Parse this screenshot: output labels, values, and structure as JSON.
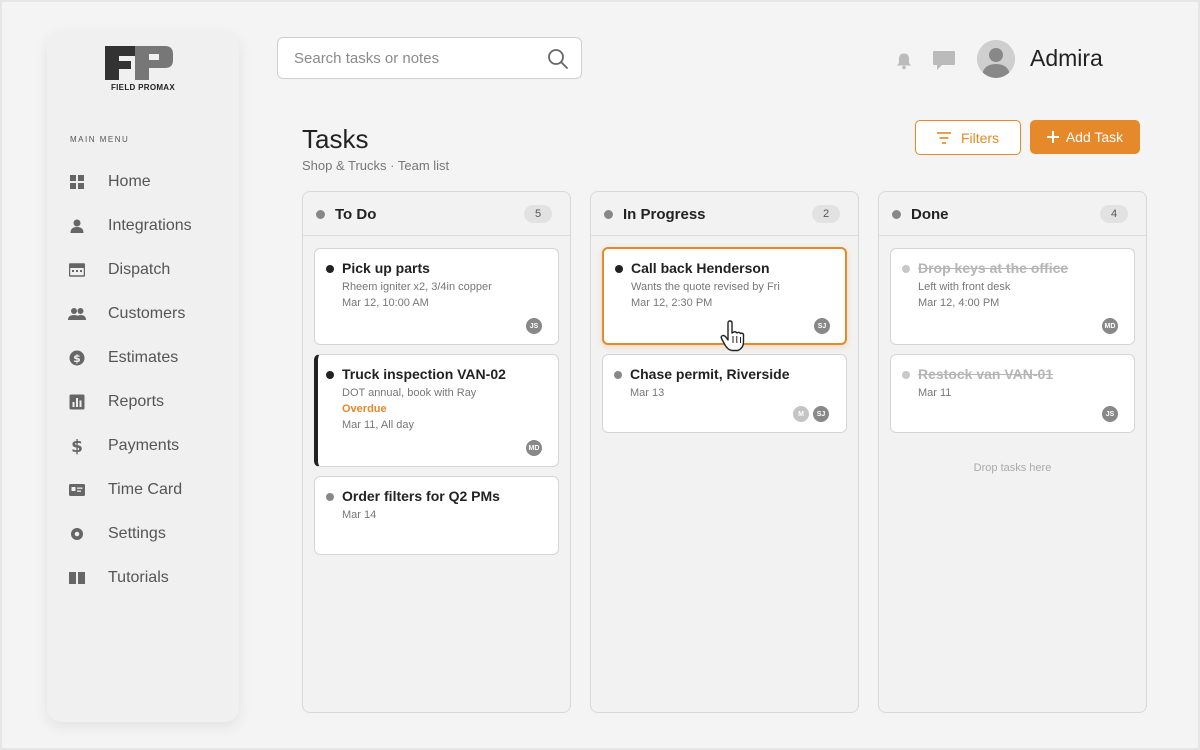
{
  "app": {
    "logo_text": "FIELD PROMAX"
  },
  "sidebar": {
    "caption": "MAIN MENU",
    "items": [
      {
        "label": "Home",
        "icon": "grid-icon"
      },
      {
        "label": "Integrations",
        "icon": "user-icon"
      },
      {
        "label": "Dispatch",
        "icon": "calendar-icon"
      },
      {
        "label": "Customers",
        "icon": "users-icon"
      },
      {
        "label": "Estimates",
        "icon": "dollar-circle-icon"
      },
      {
        "label": "Reports",
        "icon": "bar-chart-icon"
      },
      {
        "label": "Payments",
        "icon": "dollar-icon"
      },
      {
        "label": "Time Card",
        "icon": "id-card-icon"
      },
      {
        "label": "Settings",
        "icon": "gear-icon"
      },
      {
        "label": "Tutorials",
        "icon": "book-icon"
      }
    ]
  },
  "search": {
    "placeholder": "Search tasks or notes"
  },
  "user": {
    "name": "Admira"
  },
  "header": {
    "title": "Tasks",
    "subtitle": "Shop & Trucks · Team list",
    "filters_label": "Filters",
    "add_label": "Add Task"
  },
  "colors": {
    "accent": "#e5892a",
    "text": "#222222",
    "muted": "#777777"
  },
  "board": {
    "todo": {
      "title": "To Do",
      "count": "5",
      "cards": [
        {
          "title": "Pick up parts",
          "line1": "Rheem igniter x2, 3/4in copper",
          "line2": "Mar 12, 10:00 AM",
          "assignee": "JS"
        },
        {
          "title": "Truck inspection VAN-02",
          "line1": "DOT annual, book with Ray",
          "status": "Overdue",
          "line2": "Mar 11, All day",
          "assignee": "MD"
        },
        {
          "title": "Order filters for Q2 PMs",
          "line1": "Mar 14"
        }
      ]
    },
    "progress": {
      "title": "In Progress",
      "count": "2",
      "cards": [
        {
          "title": "Call back Henderson",
          "line1": "Wants the quote revised by Fri",
          "line2": "Mar 12, 2:30 PM",
          "assignee": "SJ"
        },
        {
          "title": "Chase permit, Riverside",
          "line1": "Mar 13",
          "assignee_a": "M",
          "assignee_b": "SJ"
        }
      ]
    },
    "done": {
      "title": "Done",
      "count": "4",
      "cards": [
        {
          "title": "Drop keys at the office",
          "line1": "Left with front desk",
          "line2": "Mar 12, 4:00 PM",
          "assignee": "MD"
        },
        {
          "title": "Restock van VAN-01",
          "line1": "Mar 11",
          "assignee": "JS"
        }
      ],
      "drop_hint": "Drop tasks here"
    }
  }
}
